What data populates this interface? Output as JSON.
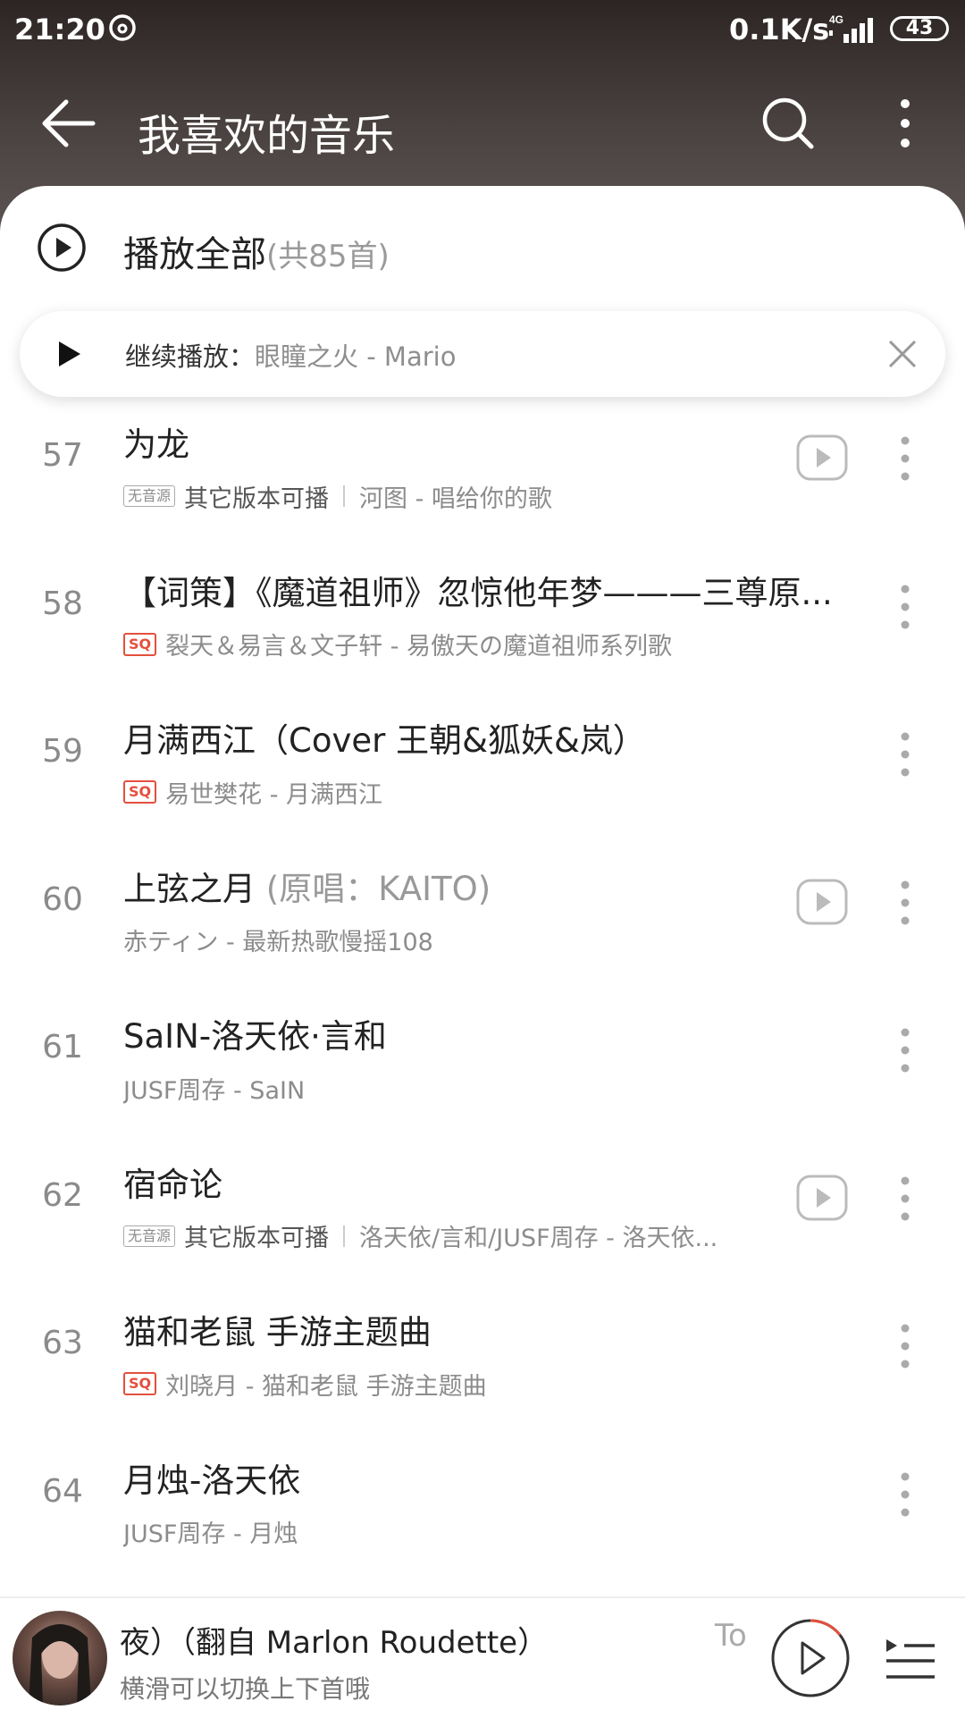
{
  "status_bar": {
    "time": "21:20",
    "speed": "0.1K/s",
    "network": "4G",
    "battery": "43"
  },
  "header": {
    "title": "我喜欢的音乐"
  },
  "play_all": {
    "label": "播放全部",
    "count": "(共85首)"
  },
  "resume": {
    "label": "继续播放：",
    "song": "眼瞳之火 - Mario"
  },
  "songs": [
    {
      "num": "57",
      "title": "为龙",
      "subtitle": "",
      "badge": "无音源",
      "other": "其它版本可播",
      "meta": "河图 - 唱给你的歌",
      "mv": true
    },
    {
      "num": "58",
      "title": "【词策】《魔道祖师》忽惊他年梦———三尊原...",
      "subtitle": "",
      "badge": "SQ",
      "other": "",
      "meta": "裂天＆易言＆文子轩 - 易傲天の魔道祖师系列歌",
      "mv": false
    },
    {
      "num": "59",
      "title": "月满西江（Cover 王朝&狐妖&岚）",
      "subtitle": "",
      "badge": "SQ",
      "other": "",
      "meta": "易世樊花 - 月满西江",
      "mv": false
    },
    {
      "num": "60",
      "title": "上弦之月 ",
      "subtitle": "(原唱：KAITO)",
      "badge": "",
      "other": "",
      "meta": "赤ティン - 最新热歌慢摇108",
      "mv": true
    },
    {
      "num": "61",
      "title": "SaIN-洛天依·言和",
      "subtitle": "",
      "badge": "",
      "other": "",
      "meta": "JUSF周存 - SaIN",
      "mv": false
    },
    {
      "num": "62",
      "title": "宿命论",
      "subtitle": "",
      "badge": "无音源",
      "other": "其它版本可播",
      "meta": "洛天依/言和/JUSF周存 - 洛天依...",
      "mv": true
    },
    {
      "num": "63",
      "title": "猫和老鼠 手游主题曲",
      "subtitle": "",
      "badge": "SQ",
      "other": "",
      "meta": "刘晓月 - 猫和老鼠 手游主题曲",
      "mv": false
    },
    {
      "num": "64",
      "title": "月烛-洛天依",
      "subtitle": "",
      "badge": "",
      "other": "",
      "meta": "JUSF周存 - 月烛",
      "mv": false
    }
  ],
  "mini_player": {
    "title": "夜）（翻自 Marlon Roudette）",
    "next_title": "To",
    "hint": "横滑可以切换上下首哦"
  },
  "colors": {
    "accent": "#e3503e",
    "header_top": "#2c2523",
    "header_bottom": "#5c5452"
  },
  "icons": [
    "back-arrow-icon",
    "search-icon",
    "more-vertical-icon",
    "play-circle-icon",
    "play-icon",
    "close-icon",
    "mv-play-icon",
    "playlist-icon"
  ]
}
